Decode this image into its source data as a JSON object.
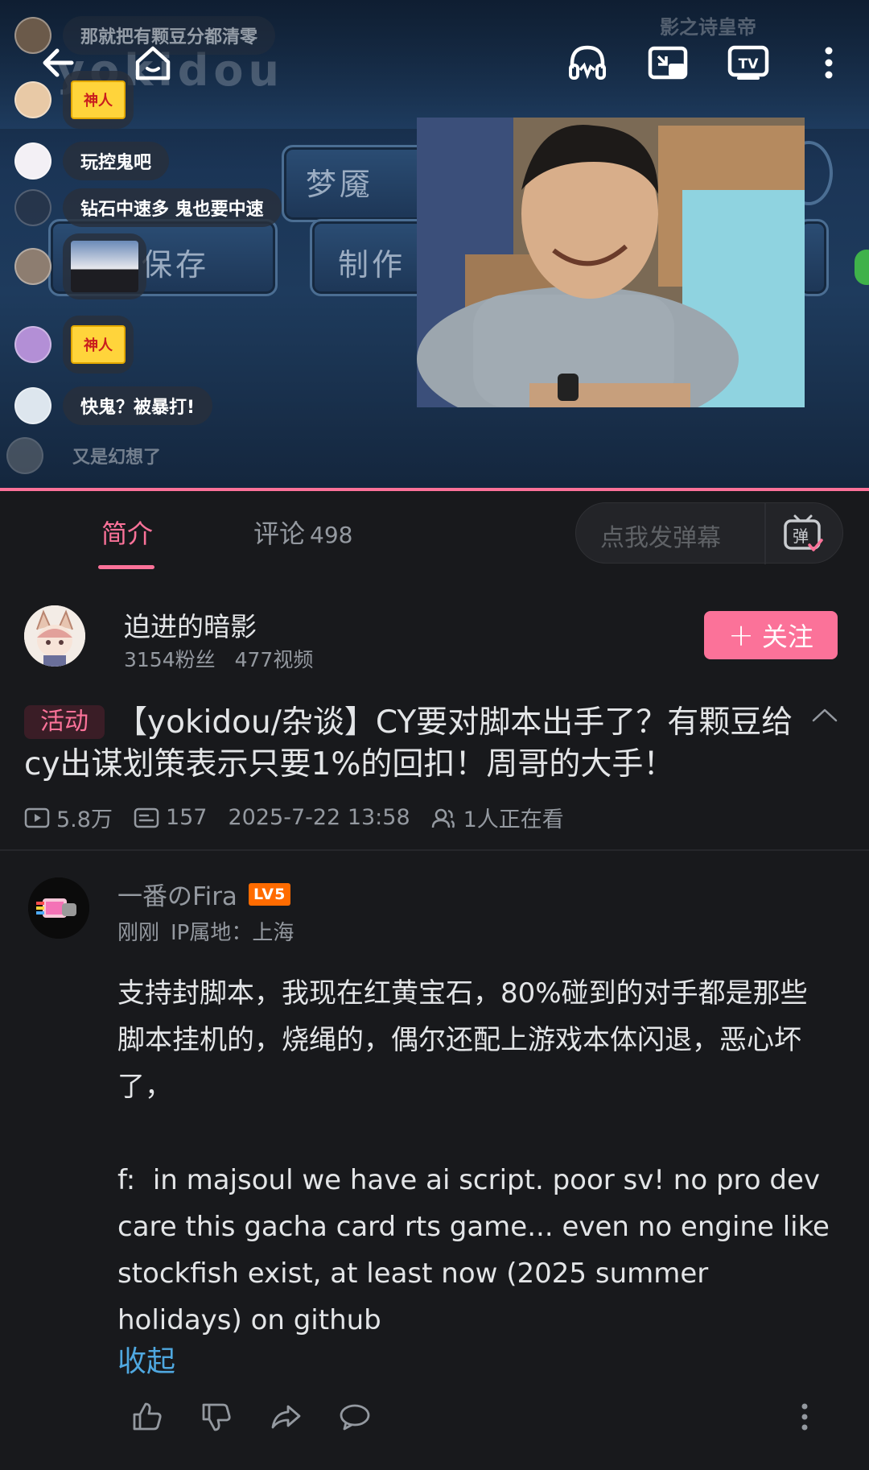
{
  "video": {
    "watermark": "yokidou",
    "streamer_name": "影之诗皇帝",
    "menu_items": [
      "梦魇",
      "保存",
      "制作"
    ],
    "danmaku": [
      {
        "text": "那就把有颗豆分都清零",
        "type": "text"
      },
      {
        "text": "神人",
        "type": "sticker"
      },
      {
        "text": "玩控鬼吧",
        "type": "text"
      },
      {
        "text": "钻石中速多 鬼也要中速",
        "type": "text"
      },
      {
        "text": "",
        "type": "image"
      },
      {
        "text": "神人",
        "type": "sticker"
      },
      {
        "text": "快鬼？被暴打!",
        "type": "text"
      },
      {
        "text": "又是幻想了",
        "type": "text"
      }
    ],
    "icons": [
      "back-arrow-icon",
      "home-icon",
      "headphones-icon",
      "picture-in-picture-icon",
      "tv-cast-icon",
      "more-vertical-icon"
    ]
  },
  "tabs": {
    "intro": "简介",
    "comments": "评论",
    "comments_count": "498",
    "danmu_placeholder": "点我发弹幕",
    "danmu_icon_label": "弹"
  },
  "uploader": {
    "name": "迫进的暗影",
    "fans": "3154粉丝",
    "videos": "477视频",
    "follow_label": "关注"
  },
  "video_info": {
    "tag": "活动",
    "title": "【yokidou/杂谈】CY要对脚本出手了？有颗豆给cy出谋划策表示只要1%的回扣！周哥的大手！",
    "views": "5.8万",
    "danmaku_count": "157",
    "date": "2025-7-22 13:58",
    "watching": "1人正在看"
  },
  "comment": {
    "username": "一番のFira",
    "level": "LV5",
    "time": "刚刚",
    "ip": "IP属地：上海",
    "body": "支持封脚本，我现在红黄宝石，80%碰到的对手都是那些脚本挂机的，烧绳的，偶尔还配上游戏本体闪退，恶心坏了，\n\nf:  in majsoul we have ai script. poor sv! no pro dev care this gacha card rts game... even no engine like stockfish exist, at least now (2025 summer holidays) on github",
    "collapse_label": "收起"
  },
  "colors": {
    "accent": "#fb7299",
    "background": "#18191c",
    "link": "#4fa8e0",
    "level_badge": "#ff6b00"
  }
}
